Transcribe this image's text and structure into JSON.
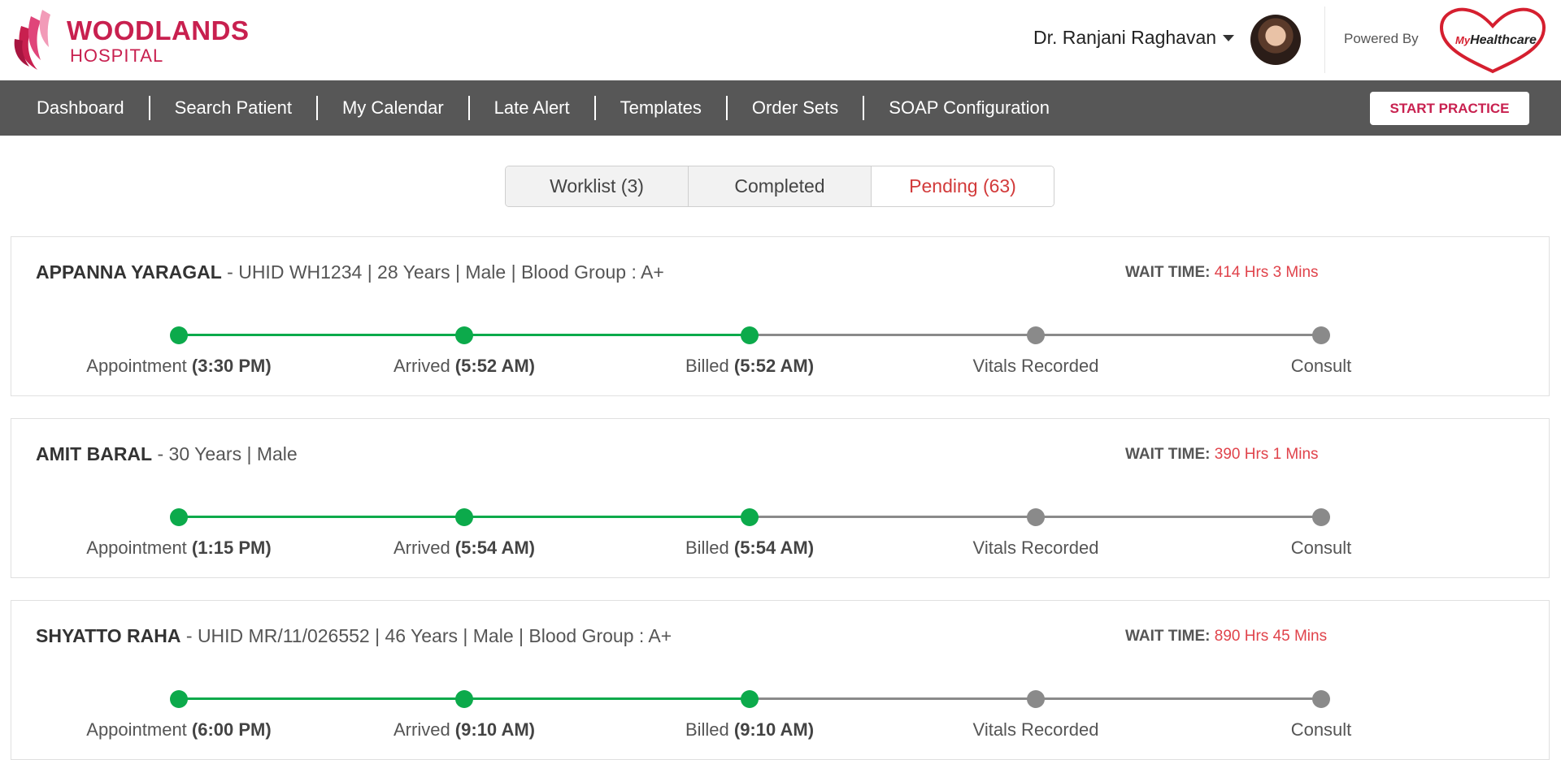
{
  "header": {
    "brand_line1": "WOODLANDS",
    "brand_line2": "HOSPITAL",
    "user_name": "Dr. Ranjani Raghavan",
    "powered_by": "Powered By",
    "partner_logo_my": "My",
    "partner_logo_text": "Healthcare",
    "brand_color": "#c8204f"
  },
  "nav": {
    "items": [
      "Dashboard",
      "Search Patient",
      "My Calendar",
      "Late Alert",
      "Templates",
      "Order Sets",
      "SOAP Configuration"
    ],
    "start_button": "START PRACTICE",
    "bg_color": "#575757"
  },
  "tabs": {
    "items": [
      "Worklist (3)",
      "Completed",
      "Pending (63)"
    ],
    "active_index": 2,
    "active_color": "#d23a3a"
  },
  "wait_label": "WAIT TIME:",
  "progress_color_done": "#0caa4b",
  "progress_color_pending": "#8a8a8a",
  "patients": [
    {
      "name": "APPANNA YARAGAL",
      "details": " - UHID WH1234 | 28 Years | Male | Blood Group : A+",
      "wait_time": "414 Hrs 3 Mins",
      "steps": [
        {
          "label": "Appointment",
          "time": "(3:30 PM)",
          "done": true
        },
        {
          "label": "Arrived",
          "time": "(5:52 AM)",
          "done": true
        },
        {
          "label": "Billed",
          "time": "(5:52 AM)",
          "done": true
        },
        {
          "label": "Vitals Recorded",
          "time": "",
          "done": false
        },
        {
          "label": "Consult",
          "time": "",
          "done": false
        }
      ]
    },
    {
      "name": "AMIT BARAL",
      "details": " - 30 Years | Male",
      "wait_time": "390 Hrs 1 Mins",
      "steps": [
        {
          "label": "Appointment",
          "time": "(1:15 PM)",
          "done": true
        },
        {
          "label": "Arrived",
          "time": "(5:54 AM)",
          "done": true
        },
        {
          "label": "Billed",
          "time": "(5:54 AM)",
          "done": true
        },
        {
          "label": "Vitals Recorded",
          "time": "",
          "done": false
        },
        {
          "label": "Consult",
          "time": "",
          "done": false
        }
      ]
    },
    {
      "name": "SHYATTO RAHA",
      "details": " - UHID MR/11/026552 | 46 Years | Male | Blood Group : A+",
      "wait_time": "890 Hrs 45 Mins",
      "steps": [
        {
          "label": "Appointment",
          "time": "(6:00 PM)",
          "done": true
        },
        {
          "label": "Arrived",
          "time": "(9:10 AM)",
          "done": true
        },
        {
          "label": "Billed",
          "time": "(9:10 AM)",
          "done": true
        },
        {
          "label": "Vitals Recorded",
          "time": "",
          "done": false
        },
        {
          "label": "Consult",
          "time": "",
          "done": false
        }
      ]
    }
  ]
}
